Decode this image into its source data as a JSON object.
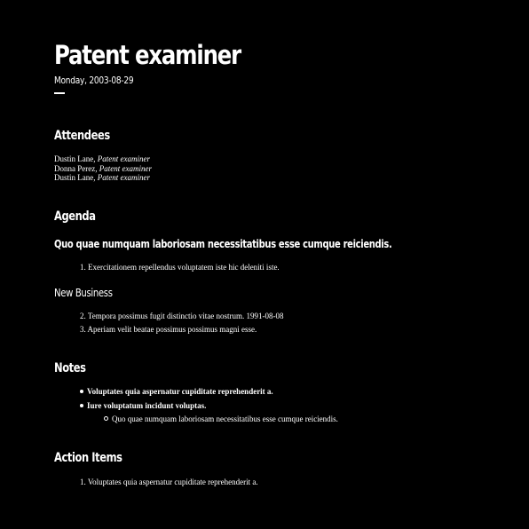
{
  "title": "Patent examiner",
  "date": "Monday, 2003-08-29",
  "attendees": {
    "heading": "Attendees",
    "people": [
      {
        "name": "Dustin Lane,",
        "role": "Patent examiner"
      },
      {
        "name": "Donna Perez,",
        "role": "Patent examiner"
      },
      {
        "name": "Dustin Lane,",
        "role": "Patent examiner"
      }
    ]
  },
  "agenda": {
    "heading": "Agenda",
    "section1_title": "Quo quae numquam laboriosam necessitatibus esse cumque reiciendis.",
    "section1_items": [
      {
        "num": "1.",
        "text": "Exercitationem repellendus voluptatem iste hic deleniti iste."
      }
    ],
    "section2_title": "New Business",
    "section2_items": [
      {
        "num": "2.",
        "text": "Tempora possimus fugit distinctio vitae nostrum. 1991-08-08"
      },
      {
        "num": "3.",
        "text": "Aperiam velit beatae possimus possimus magni esse."
      }
    ]
  },
  "notes": {
    "heading": "Notes",
    "items": [
      {
        "text": "Voluptates quia aspernatur cupiditate reprehenderit a."
      },
      {
        "text": "Iure voluptatum incidunt voluptas."
      }
    ],
    "subitems": [
      {
        "text": "Quo quae numquam laboriosam necessitatibus esse cumque reiciendis."
      }
    ]
  },
  "action_items": {
    "heading": "Action Items",
    "items": [
      {
        "num": "1.",
        "text": "Voluptates quia aspernatur cupiditate reprehenderit a."
      }
    ]
  }
}
